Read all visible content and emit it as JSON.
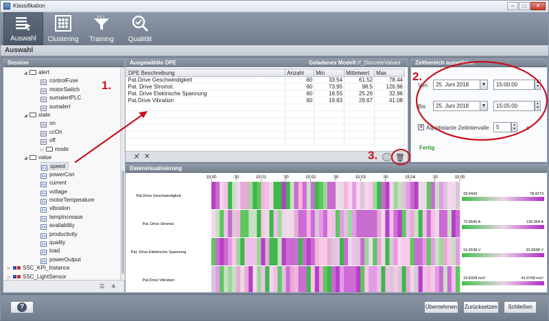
{
  "window": {
    "title": "Klassifikation"
  },
  "toolbar": {
    "items": [
      {
        "label": "Auswahl",
        "icon": "selection-list-icon",
        "active": true
      },
      {
        "label": "Clustering",
        "icon": "cluster-grid-icon",
        "active": false
      },
      {
        "label": "Training",
        "icon": "filter-funnel-icon",
        "active": false
      },
      {
        "label": "Qualität",
        "icon": "magnifier-check-icon",
        "active": false
      }
    ]
  },
  "section": {
    "title": "Auswahl"
  },
  "session": {
    "title": "Session",
    "tree": [
      {
        "label": "alert",
        "type": "folder",
        "level": 1,
        "expanded": true
      },
      {
        "label": "controlFuse",
        "type": "bool",
        "level": 2
      },
      {
        "label": "motorSwitch",
        "type": "bool",
        "level": 2
      },
      {
        "label": "sumalertPLC",
        "type": "bool",
        "level": 2
      },
      {
        "label": "sumalert",
        "type": "bool",
        "level": 2
      },
      {
        "label": "state",
        "type": "folder",
        "level": 1,
        "expanded": true
      },
      {
        "label": "on",
        "type": "bool",
        "level": 2
      },
      {
        "label": "ccOn",
        "type": "bool",
        "level": 2
      },
      {
        "label": "off",
        "type": "bool",
        "level": 2
      },
      {
        "label": "mode",
        "type": "folder",
        "level": 2,
        "expanded": false
      },
      {
        "label": "value",
        "type": "folder",
        "level": 1,
        "expanded": true
      },
      {
        "label": "speed",
        "type": "float",
        "level": 2,
        "selected": true
      },
      {
        "label": "powerCon",
        "type": "float",
        "level": 2
      },
      {
        "label": "current",
        "type": "float",
        "level": 2
      },
      {
        "label": "voltage",
        "type": "float",
        "level": 2
      },
      {
        "label": "motorTemperature",
        "type": "float",
        "level": 2
      },
      {
        "label": "vibration",
        "type": "float",
        "level": 2
      },
      {
        "label": "tempIncrease",
        "type": "float",
        "level": 2
      },
      {
        "label": "availability",
        "type": "float",
        "level": 2
      },
      {
        "label": "productivity",
        "type": "float",
        "level": 2
      },
      {
        "label": "quality",
        "type": "float",
        "level": 2
      },
      {
        "label": "load",
        "type": "float",
        "level": 2
      },
      {
        "label": "powerOutput",
        "type": "float",
        "level": 2
      },
      {
        "label": "SSC_KPI_Instance",
        "type": "instance",
        "level": 0
      },
      {
        "label": "SSC_LightSensor",
        "type": "instance",
        "level": 0
      }
    ]
  },
  "dpe": {
    "title": "Ausgewählte DPE",
    "model_label": "Geladenes Modell:",
    "model_value": "rf_DiscreteValues",
    "columns": [
      "DPE Beschreibung",
      "Anzahl",
      "Min",
      "Mittelwert",
      "Max"
    ],
    "rows": [
      [
        "Pat.Drive Geschwindigkeit",
        "60",
        "33.54",
        "61.52",
        "78.44"
      ],
      [
        "Pat. Drive Stromst.",
        "60",
        "73.95",
        "98.5",
        "126.96"
      ],
      [
        "Pat. Drive Elektrische Spannung",
        "60",
        "16.55",
        "25.26",
        "32.96"
      ],
      [
        "Pat.Drive Vibration",
        "60",
        "19.83",
        "29.67",
        "41.08"
      ]
    ]
  },
  "zeitbereich": {
    "title": "Zeitbereich auswählen",
    "von_label": "Von",
    "von_date": "25. Juni 2018",
    "von_time": "15:00:00",
    "bis_label": "Bis",
    "bis_date": "25. Juni 2018",
    "bis_time": "15:05:00",
    "aequi_label": "Äquidistante Zeitintervalle",
    "aequi_checked": true,
    "aequi_value": "5",
    "aequi_unit": "s",
    "status": "Fertig"
  },
  "viz": {
    "title": "Datenvisualisierung",
    "time_ticks": [
      "15:00",
      ":30",
      "15:01",
      ":30",
      "15:02",
      ":30",
      "15:03",
      ":30",
      "15:04",
      ":30",
      "15:05"
    ],
    "rows": [
      {
        "label": "Pat.Drive Geschwindigkeit",
        "min": "33.5443",
        "max": "78.4373"
      },
      {
        "label": "Pat. Drive Stromst.",
        "min": "73.9545 A",
        "max": "126.964 A"
      },
      {
        "label": "Pat. Drive Elektrische Spannung",
        "min": "16.5538 V",
        "max": "32.9598 V"
      },
      {
        "label": "Pat.Drive Vibration",
        "min": "19.8328 m/s²",
        "max": "41.0768 m/s²"
      }
    ],
    "colors": {
      "low": "#3fbf4a",
      "mid": "#e9d3e6",
      "high": "#b02ec4"
    }
  },
  "annotations": [
    "1.",
    "2.",
    "3."
  ],
  "footer": {
    "help": "?",
    "apply": "Übernehmen",
    "reset": "Zurücksetzen",
    "close": "Schließen"
  }
}
